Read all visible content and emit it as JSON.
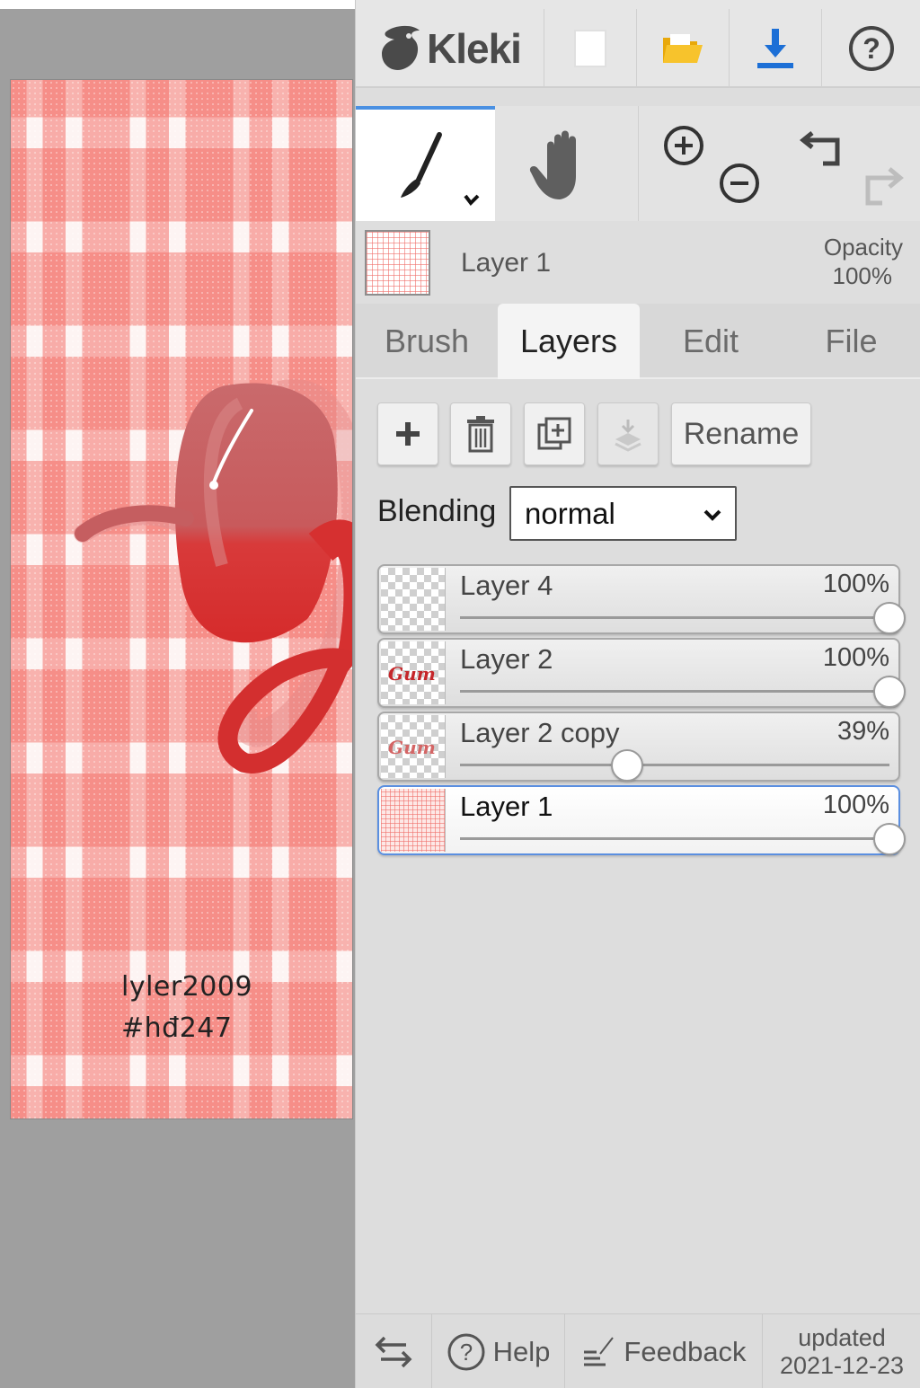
{
  "canvas": {
    "signature_line1": "lyler2009",
    "signature_line2": "#hđ247"
  },
  "header": {
    "app_name": "Kleki",
    "icons": [
      "new-image-icon",
      "open-folder-icon",
      "save-download-icon",
      "help-icon"
    ]
  },
  "tools": {
    "active": "brush",
    "items": [
      "brush-icon",
      "hand-icon",
      "zoom-in-icon",
      "zoom-out-icon",
      "undo-icon",
      "redo-icon"
    ]
  },
  "current_layer": {
    "name": "Layer 1",
    "opacity_label": "Opacity",
    "opacity_value": "100%"
  },
  "tabs": {
    "brush": "Brush",
    "layers": "Layers",
    "edit": "Edit",
    "file": "File",
    "active": "Layers"
  },
  "layer_panel": {
    "rename_label": "Rename",
    "blending_label": "Blending",
    "blending_value": "normal",
    "layers": [
      {
        "name": "Layer 4",
        "opacity": "100%",
        "opacity_fraction": 1.0,
        "active": false
      },
      {
        "name": "Layer 2",
        "opacity": "100%",
        "opacity_fraction": 1.0,
        "active": false
      },
      {
        "name": "Layer 2 copy",
        "opacity": "39%",
        "opacity_fraction": 0.39,
        "active": false
      },
      {
        "name": "Layer 1",
        "opacity": "100%",
        "opacity_fraction": 1.0,
        "active": true
      }
    ]
  },
  "footer": {
    "help_label": "Help",
    "feedback_label": "Feedback",
    "updated_line1": "updated",
    "updated_line2": "2021-12-23"
  },
  "colors": {
    "accent": "#4a90e2",
    "gingham": "#f47069",
    "script_red": "#d32f2f"
  }
}
